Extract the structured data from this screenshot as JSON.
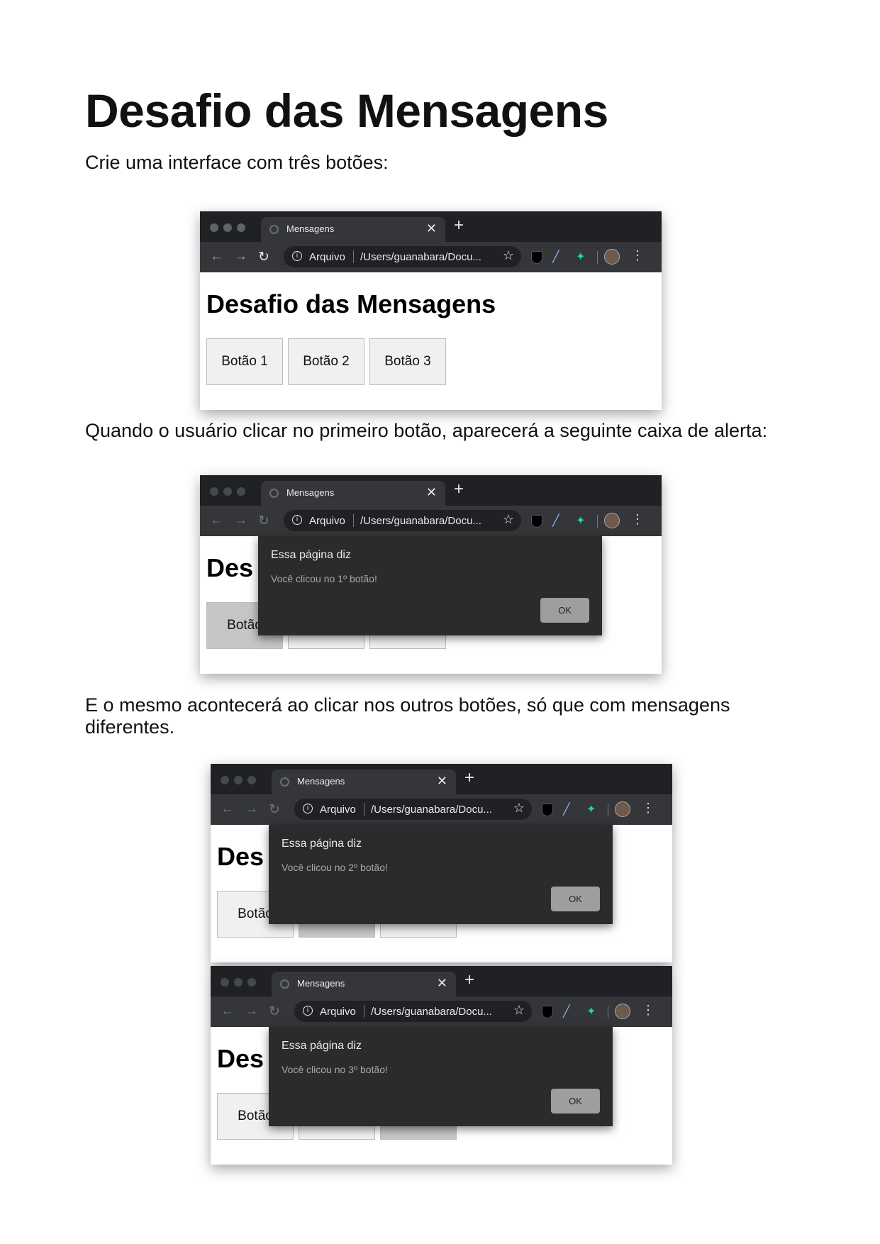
{
  "doc": {
    "title": "Desafio das Mensagens",
    "intro": "Crie uma interface com três botões:",
    "para2": "Quando o usuário clicar no primeiro botão, aparecerá a seguinte caixa de alerta:",
    "para3": "E o mesmo acontecerá ao clicar nos outros botões, só que com mensagens diferentes."
  },
  "browser": {
    "tab_title": "Mensagens",
    "site_label": "Arquivo",
    "url": "/Users/guanabara/Docu...",
    "page_heading": "Desafio das Mensagens",
    "page_heading_cut": "Des",
    "buttons": [
      "Botão 1",
      "Botão 2",
      "Botão 3"
    ],
    "button_cut": "Botão"
  },
  "dialogs": [
    {
      "title": "Essa página diz",
      "message": "Você clicou no 1º botão!",
      "ok": "OK"
    },
    {
      "title": "Essa página diz",
      "message": "Você clicou no 2º botão!",
      "ok": "OK"
    },
    {
      "title": "Essa página diz",
      "message": "Você clicou no 3º botão!",
      "ok": "OK"
    }
  ],
  "colors": {
    "chrome_dark": "#202124",
    "toolbar": "#35363a",
    "dialog_bg": "#2b2b2b",
    "extension_green": "#1ed6a0"
  }
}
